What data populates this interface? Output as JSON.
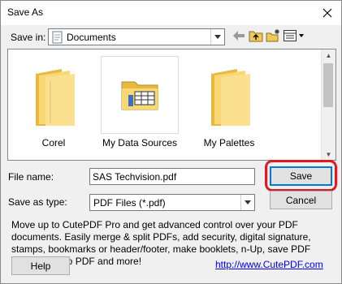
{
  "window": {
    "title": "Save As"
  },
  "save_in": {
    "label": "Save in:",
    "value": "Documents"
  },
  "files": [
    {
      "name": "Corel",
      "icon": "folder-icon"
    },
    {
      "name": "My Data Sources",
      "icon": "data-sources-folder-icon"
    },
    {
      "name": "My Palettes",
      "icon": "folder-icon"
    }
  ],
  "file_name": {
    "label": "File name:",
    "value": "SAS Techvision.pdf"
  },
  "save_as_type": {
    "label": "Save as type:",
    "value": "PDF Files (*.pdf)"
  },
  "buttons": {
    "save": "Save",
    "cancel": "Cancel",
    "help": "Help"
  },
  "info_text": "Move up to CutePDF Pro and get advanced control over your PDF documents. Easily merge & split PDFs, add security, digital signature, stamps, bookmarks or header/footer, make booklets, n-Up, save PDF forms, scan to PDF and more!",
  "link_text": "http://www.CutePDF.com",
  "colors": {
    "folder": "#f8d775",
    "highlight_ring": "#e0191f",
    "link": "#0000ee"
  }
}
